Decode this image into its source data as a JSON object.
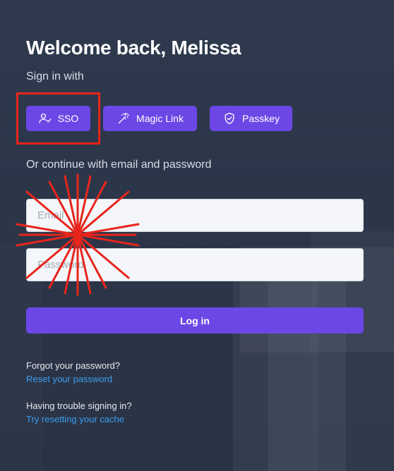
{
  "header": {
    "title": "Welcome back, Melissa",
    "subtitle": "Sign in with"
  },
  "methods": [
    {
      "label": "SSO",
      "icon": "user-check-icon"
    },
    {
      "label": "Magic Link",
      "icon": "magic-wand-icon"
    },
    {
      "label": "Passkey",
      "icon": "shield-check-icon"
    }
  ],
  "divider_text": "Or continue with email and password",
  "form": {
    "email": {
      "placeholder": "Email",
      "value": ""
    },
    "password": {
      "placeholder": "Password",
      "value": ""
    },
    "submit_label": "Log in"
  },
  "help": {
    "forgot_question": "Forgot your password?",
    "forgot_link": "Reset your password",
    "trouble_question": "Having trouble signing in?",
    "trouble_link": "Try resetting your cache"
  },
  "colors": {
    "accent": "#6c47e6",
    "link": "#3b9cf0",
    "annotation": "#e8251c",
    "background": "#2c3649"
  }
}
